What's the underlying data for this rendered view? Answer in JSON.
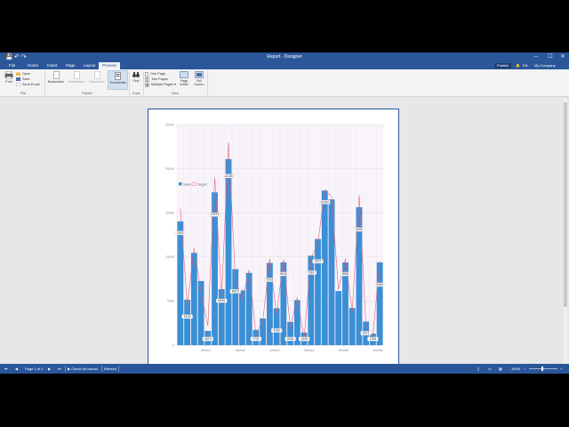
{
  "window": {
    "title": "Report - Designer",
    "qa_save": "💾",
    "qa_undo": "↶",
    "qa_redo": "↷",
    "ctl_min": "─",
    "ctl_max": "☐",
    "ctl_close": "✕"
  },
  "tabs": [
    "File",
    "Home",
    "Insert",
    "Page",
    "Layout",
    "Preview"
  ],
  "active_tab": "Preview",
  "tabbar_right": {
    "publish": "Publish",
    "lang": "EN",
    "company": "My Company"
  },
  "ribbon": {
    "file": {
      "print": "Print",
      "open": "Open",
      "save": "Save",
      "send_email": "Send Email",
      "label": "File"
    },
    "panels": {
      "bookmarks": "Bookmarks",
      "parameters": "Parameters",
      "resources": "Resources",
      "thumbnails": "Thumbnails",
      "label": "Panels"
    },
    "tools": {
      "find": "Find",
      "label": "Tools"
    },
    "view": {
      "one_page": "One Page",
      "two_pages": "Two Pages",
      "multiple_pages": "Multiple Pages",
      "page_width": "Page Width",
      "full_screen": "Full Screen",
      "label": "View"
    }
  },
  "statusbar": {
    "page": "Page 1 of 1",
    "check": "Check for Issues",
    "refresh": "Refresh",
    "zoom": "100%"
  },
  "chart_data": {
    "type": "bar",
    "series": [
      {
        "name": "Sales",
        "color": "#3a8fd6"
      },
      {
        "name": "Target",
        "color": "#e0607a"
      }
    ],
    "y_ticks": [
      "25000",
      "20000",
      "15000",
      "10000",
      "5000",
      "0"
    ],
    "x_ticks": [
      "Week1",
      "Week2",
      "Week3",
      "Week4",
      "Week5",
      "Week6"
    ],
    "ylim": [
      0,
      25000
    ],
    "values": [
      14026,
      5153,
      10454,
      7264,
      1619,
      17315,
      6345,
      21085,
      8618,
      6210,
      8184,
      1731,
      3026,
      9318,
      4182,
      9383,
      2624,
      5096,
      1436,
      10132,
      12027,
      17512,
      16513,
      6129,
      9375,
      4223,
      15634,
      2671,
      1306,
      9384
    ],
    "labels": [
      "1652",
      "5153",
      "",
      "",
      "1619",
      "10975",
      "6345",
      "12185",
      "8618",
      "",
      "",
      "1731",
      "",
      "9318",
      "4182",
      "6948",
      "2624",
      "",
      "1436",
      "7662",
      "9227",
      "10262",
      "",
      "",
      "8965",
      "",
      "6496",
      "2671",
      "1306",
      "9384"
    ],
    "target": [
      15500,
      4500,
      11000,
      6000,
      2200,
      19000,
      5500,
      23000,
      7500,
      5200,
      8500,
      1200,
      2800,
      9800,
      3500,
      9700,
      2000,
      5400,
      800,
      9800,
      11500,
      17600,
      16800,
      6300,
      9800,
      3800,
      17000,
      2200,
      1000,
      9500
    ]
  }
}
